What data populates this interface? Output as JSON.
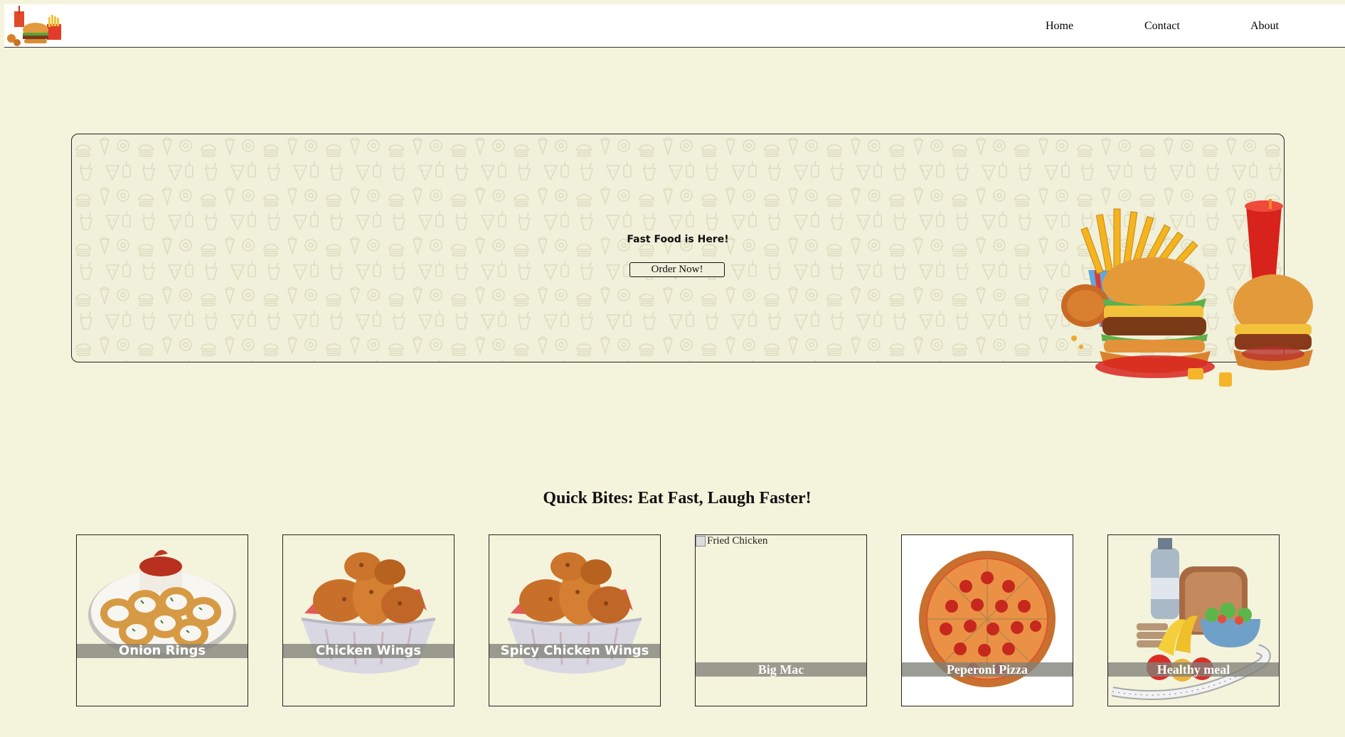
{
  "nav": {
    "links": [
      "Home",
      "Contact",
      "About"
    ]
  },
  "hero": {
    "title": "Fast Food is Here!",
    "button": "Order Now!"
  },
  "menu": {
    "title": "Quick Bites: Eat Fast, Laugh Faster!",
    "items": [
      {
        "label": "Onion Rings"
      },
      {
        "label": "Chicken Wings"
      },
      {
        "label": "Spicy Chicken Wings"
      },
      {
        "label": "Big Mac",
        "alt": "Fried Chicken"
      },
      {
        "label": "Peperoni Pizza"
      },
      {
        "label": "Healthy meal"
      }
    ]
  },
  "colors": {
    "page_bg": "#f4f3dc",
    "header_bg": "#ffffff",
    "label_bar": "#808078"
  }
}
